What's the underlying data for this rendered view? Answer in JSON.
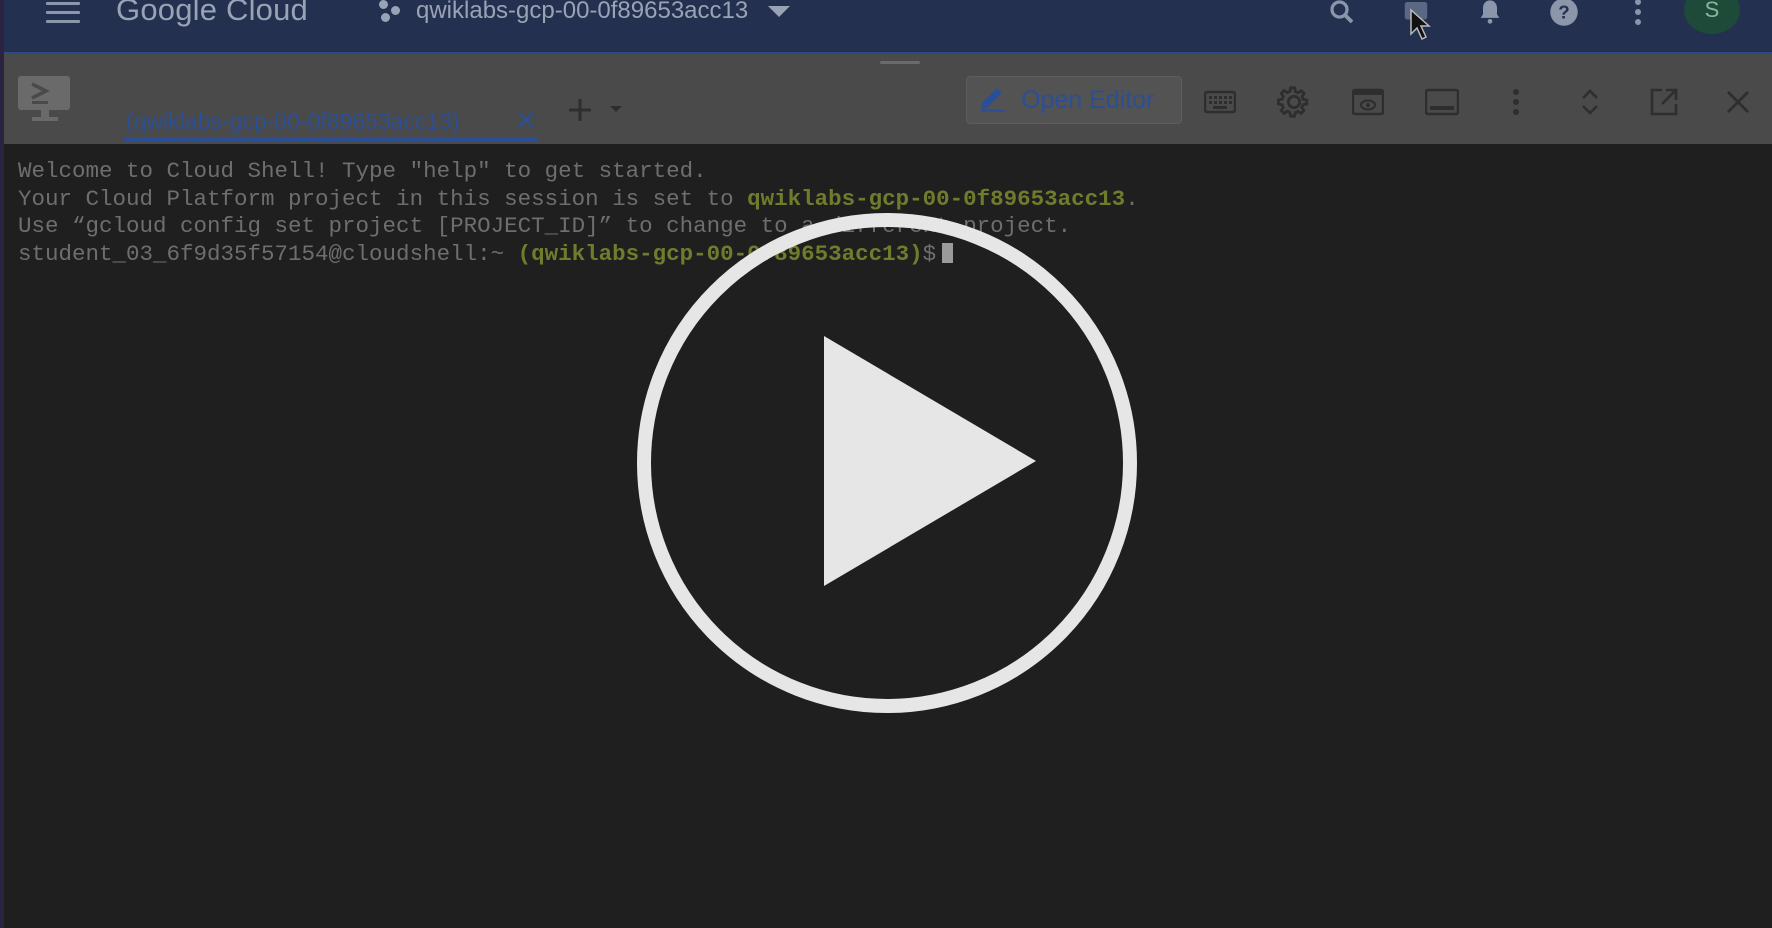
{
  "topbar": {
    "brand": "Google Cloud",
    "project_name": "qwiklabs-gcp-00-0f89653acc13",
    "avatar_initial": "S",
    "icons": [
      "menu-icon",
      "project-icon",
      "search-icon",
      "cloud-shell-icon",
      "notifications-icon",
      "help-icon",
      "more-vert-icon"
    ]
  },
  "shell_toolbar": {
    "tab_label": "(qwiklabs-gcp-00-0f89653acc13)",
    "open_editor_label": "Open Editor",
    "icons": [
      "terminal-icon",
      "close-tab-icon",
      "add-tab-icon",
      "pencil-icon",
      "keyboard-icon",
      "gear-icon",
      "web-preview-icon",
      "panel-icon",
      "more-vert-icon",
      "expand-icon",
      "open-new-window-icon",
      "close-icon"
    ]
  },
  "terminal": {
    "line1": "Welcome to Cloud Shell! Type \"help\" to get started.",
    "line2_prefix": "Your Cloud Platform project in this session is set to ",
    "line2_project": "qwiklabs-gcp-00-0f89653acc13",
    "line2_suffix": ".",
    "line3": "Use “gcloud config set project [PROJECT_ID]” to change to a different project.",
    "prompt_user": "student_03_6f9d35f57154@cloudshell:~ ",
    "prompt_project": "(qwiklabs-gcp-00-0f89653acc13)",
    "prompt_symbol": "$"
  },
  "overlay": {
    "icon": "play-icon",
    "color": "#e6e6e6"
  },
  "colors": {
    "topbar": "#23304f",
    "toolbar": "#4a4a4a",
    "terminal_bg": "#1f1f1f",
    "accent": "#2b4f96",
    "project_highlight": "#717b2c"
  }
}
